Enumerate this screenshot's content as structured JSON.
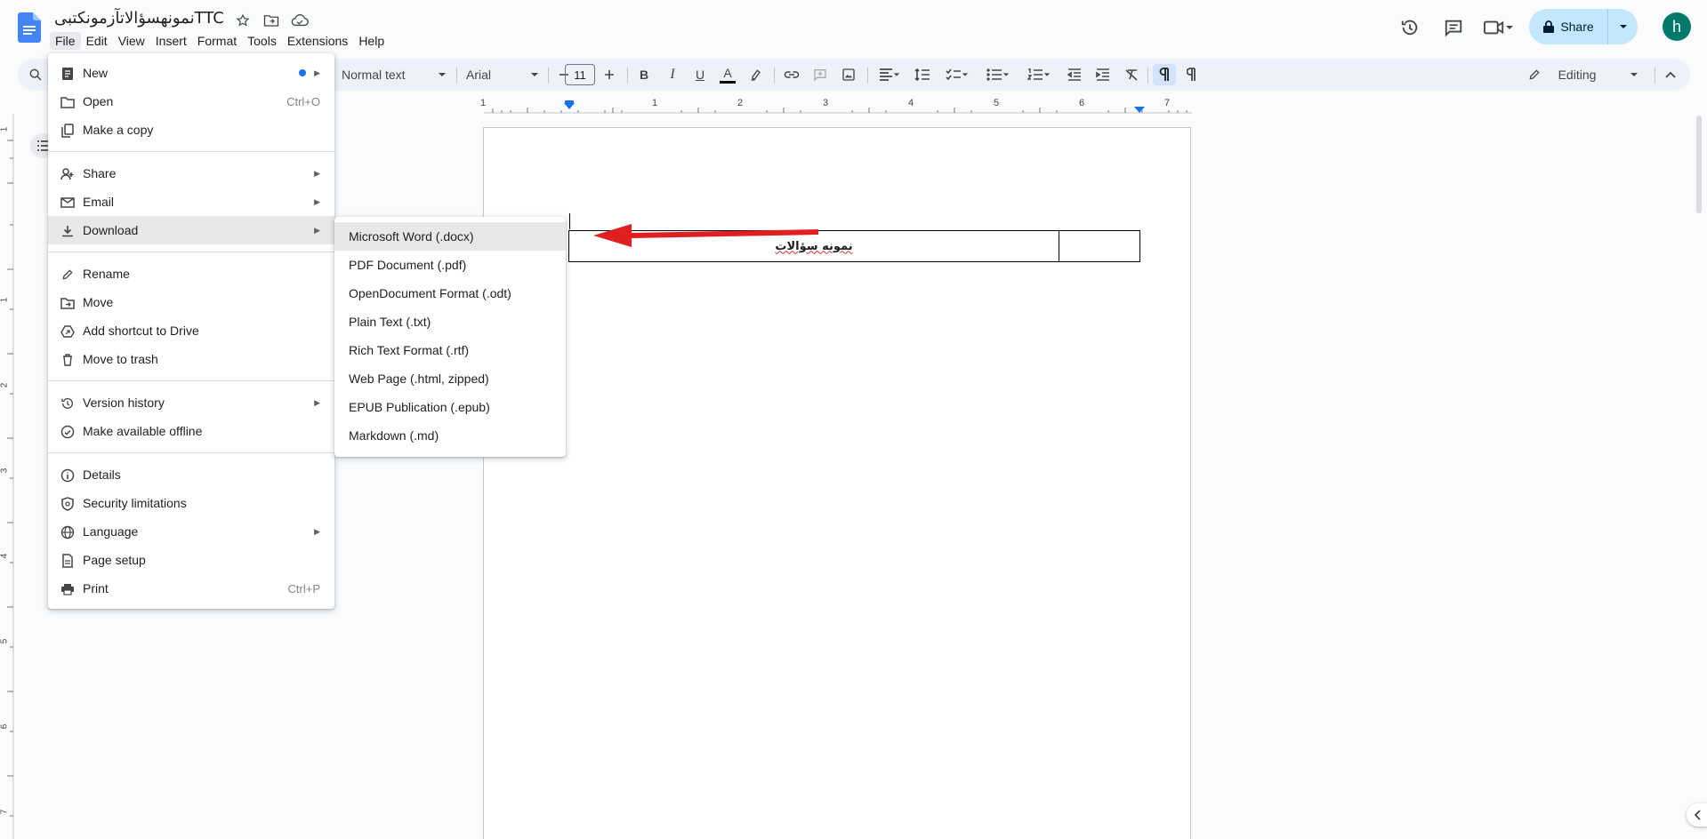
{
  "doc": {
    "title": "نمونهسؤالاتآزمونکتبیTTC"
  },
  "menubar": [
    "File",
    "Edit",
    "View",
    "Insert",
    "Format",
    "Tools",
    "Extensions",
    "Help"
  ],
  "header": {
    "share_label": "Share",
    "avatar_letter": "h"
  },
  "toolbar": {
    "style": "Normal text",
    "font": "Arial",
    "font_size": "11",
    "mode": "Editing"
  },
  "ruler_numbers": [
    "1",
    "1",
    "2",
    "3",
    "4",
    "5",
    "6",
    "7"
  ],
  "left_ruler_numbers": [
    "1",
    "1",
    "2",
    "3",
    "4",
    "5",
    "6",
    "7"
  ],
  "file_menu": {
    "new": "New",
    "open": "Open",
    "open_shortcut": "Ctrl+O",
    "copy": "Make a copy",
    "share": "Share",
    "email": "Email",
    "download": "Download",
    "rename": "Rename",
    "move": "Move",
    "shortcut": "Add shortcut to Drive",
    "trash": "Move to trash",
    "version": "Version history",
    "offline": "Make available offline",
    "details": "Details",
    "security": "Security limitations",
    "language": "Language",
    "page_setup": "Page setup",
    "print": "Print",
    "print_shortcut": "Ctrl+P"
  },
  "download_menu": [
    "Microsoft Word (.docx)",
    "PDF Document (.pdf)",
    "OpenDocument Format (.odt)",
    "Plain Text (.txt)",
    "Rich Text Format (.rtf)",
    "Web Page (.html, zipped)",
    "EPUB Publication (.epub)",
    "Markdown (.md)"
  ],
  "table": {
    "cell_text": "نمونه سؤالات"
  },
  "colors": {
    "accent": "#1a73e8",
    "share_bg": "#c2e7ff",
    "avatar": "#00796b",
    "arrow": "#e02020"
  }
}
